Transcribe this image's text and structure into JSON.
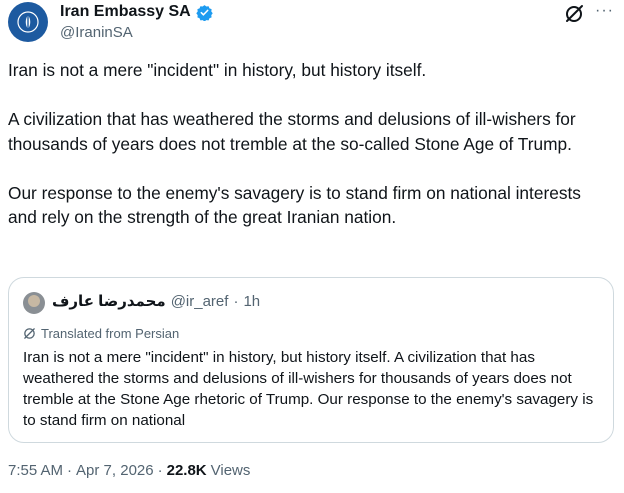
{
  "author": {
    "display_name": "Iran Embassy SA",
    "handle": "@IraninSA",
    "verified": true,
    "avatar_color": "#1d5aa0",
    "verified_color": "#1d9bf0"
  },
  "header_icons": {
    "grok": "grok-icon",
    "more": "···"
  },
  "tweet": {
    "paragraphs": [
      "Iran is not a mere \"incident\" in history, but history itself.",
      "A civilization that has weathered the storms and delusions of ill-wishers for thousands of years does not tremble at the so-called Stone Age of Trump.",
      "Our response to the enemy's savagery is to stand firm on national interests and rely on the strength of the great Iranian nation."
    ]
  },
  "quoted": {
    "display_name": "محمدرضا عارف",
    "handle": "@ir_aref",
    "separator": "·",
    "time": "1h",
    "translated_label": "Translated from Persian",
    "text": "Iran is not a mere \"incident\" in history, but history itself. A civilization that has weathered the storms and delusions of ill-wishers for thousands of years does not tremble at the Stone Age rhetoric of Trump. Our response to the enemy's savagery is to stand firm on national"
  },
  "meta": {
    "time": "7:55 AM",
    "sep1": "·",
    "date": "Apr 7, 2026",
    "sep2": "·",
    "views_count": "22.8K",
    "views_label": "Views"
  }
}
